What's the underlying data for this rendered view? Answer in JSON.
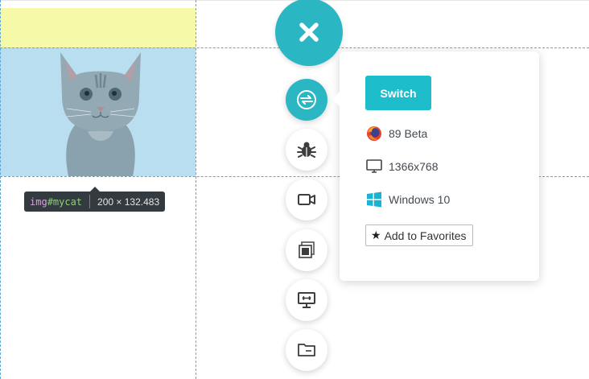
{
  "tooltip": {
    "tag": "img",
    "id": "#mycat",
    "size": "200 × 132.483"
  },
  "tools": {
    "close": "close-icon",
    "items": [
      "switch-icon",
      "bug-icon",
      "video-icon",
      "screenshots-icon",
      "responsive-icon",
      "folder-icon"
    ],
    "accent_color": "#2bb6c4"
  },
  "popup": {
    "switch_label": "Switch",
    "browser_version": "89 Beta",
    "resolution": "1366x768",
    "os": "Windows 10",
    "favorites_label": "Add to Favorites"
  },
  "colors": {
    "margin_highlight": "#f6f9a8",
    "content_highlight": "#b9def0",
    "tooltip_bg": "#333a40"
  }
}
